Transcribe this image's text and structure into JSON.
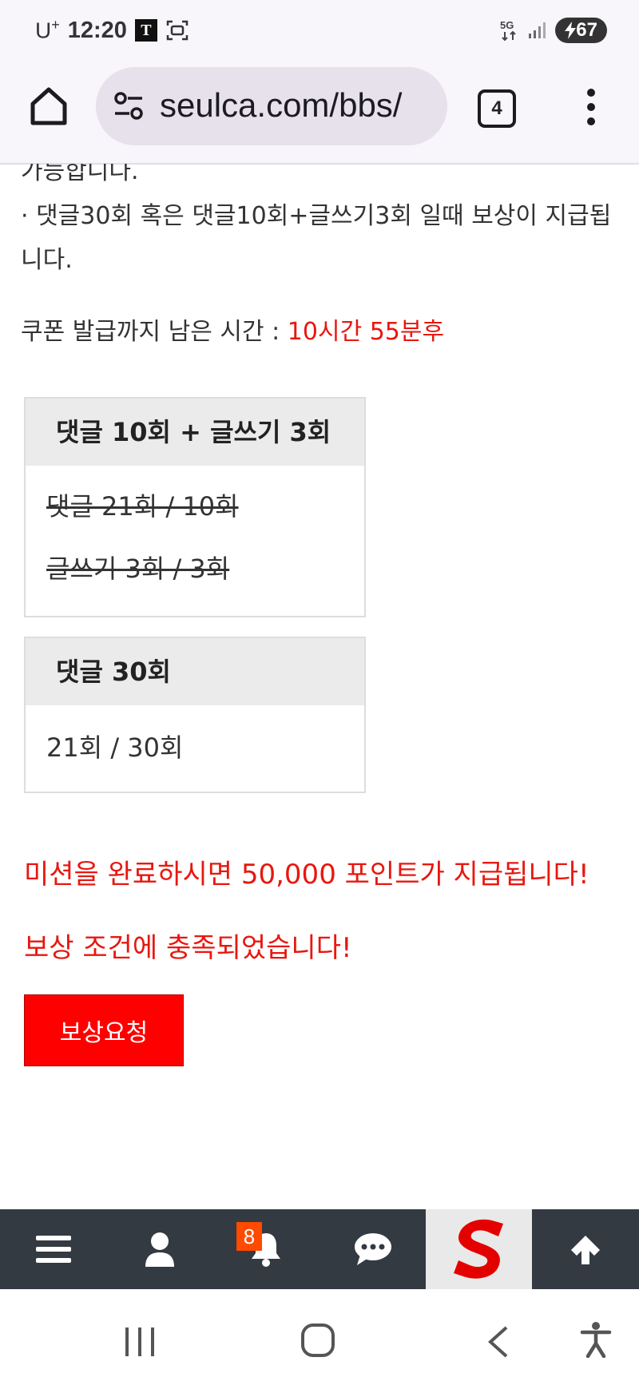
{
  "status_bar": {
    "carrier": "U",
    "carrier_sup": "+",
    "time": "12:20",
    "t_badge": "T",
    "network": "5G",
    "battery": "67"
  },
  "browser": {
    "url": "seulca.com/bbs/",
    "tab_count": "4"
  },
  "content": {
    "cut_text": "가능합니다.",
    "notice_line": "· 댓글30회 혹은 댓글10회+글쓰기3회 일때 보상이 지급됩니다.",
    "timer_label": "쿠폰 발급까지 남은 시간 : ",
    "timer_value": "10시간 55분후",
    "mission1": {
      "title": "댓글 10회 + 글쓰기 3회",
      "line1": "댓글 21회 / 10회",
      "line2": "글쓰기 3회 / 3회"
    },
    "mission2": {
      "title": "댓글 30회",
      "line1": "21회 / 30회"
    },
    "reward_msg": "미션을 완료하시면 50,000 포인트가 지급됩니다!",
    "condition_msg": "보상 조건에 충족되었습니다!",
    "reward_button": "보상요청"
  },
  "bottom_nav": {
    "items": [
      "menu-icon",
      "user-icon",
      "bell-icon",
      "chat-icon",
      "site-logo",
      "arrow-up-icon"
    ],
    "notification_count": "8"
  },
  "colors": {
    "accent_red": "#e8170f",
    "button_red": "#ff0000",
    "nav_bg": "#343a42"
  }
}
